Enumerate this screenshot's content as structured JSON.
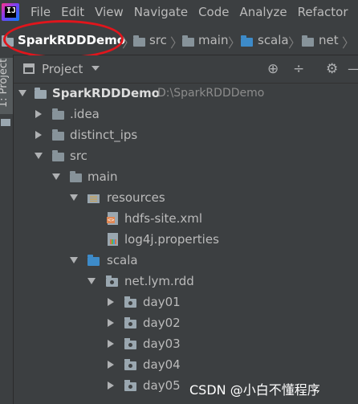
{
  "menubar": {
    "logo_text": "IJ",
    "items": [
      "File",
      "Edit",
      "View",
      "Navigate",
      "Code",
      "Analyze",
      "Refactor"
    ]
  },
  "breadcrumb": {
    "items": [
      "SparkRDDDemo",
      "src",
      "main",
      "scala",
      "net"
    ]
  },
  "left_strip": {
    "tab_label": "1: Project"
  },
  "project_panel": {
    "title": "Project",
    "buttons": [
      "⊕",
      "÷",
      "⚙",
      "—"
    ]
  },
  "tree": [
    {
      "label": "SparkRDDDemo",
      "path": "D:\\SparkRDDDemo"
    },
    {
      "label": ".idea"
    },
    {
      "label": "distinct_ips"
    },
    {
      "label": "src"
    },
    {
      "label": "main"
    },
    {
      "label": "resources"
    },
    {
      "label": "hdfs-site.xml"
    },
    {
      "label": "log4j.properties"
    },
    {
      "label": "scala"
    },
    {
      "label": "net.lym.rdd"
    },
    {
      "label": "day01"
    },
    {
      "label": "day02"
    },
    {
      "label": "day03"
    },
    {
      "label": "day04"
    },
    {
      "label": "day05"
    }
  ],
  "watermark": "CSDN @小白不懂程序",
  "colors": {
    "background": "#3c3f41",
    "annotation_circle": "#e0151c",
    "source_folder": "#3d8bc9",
    "folder": "#87939a"
  }
}
